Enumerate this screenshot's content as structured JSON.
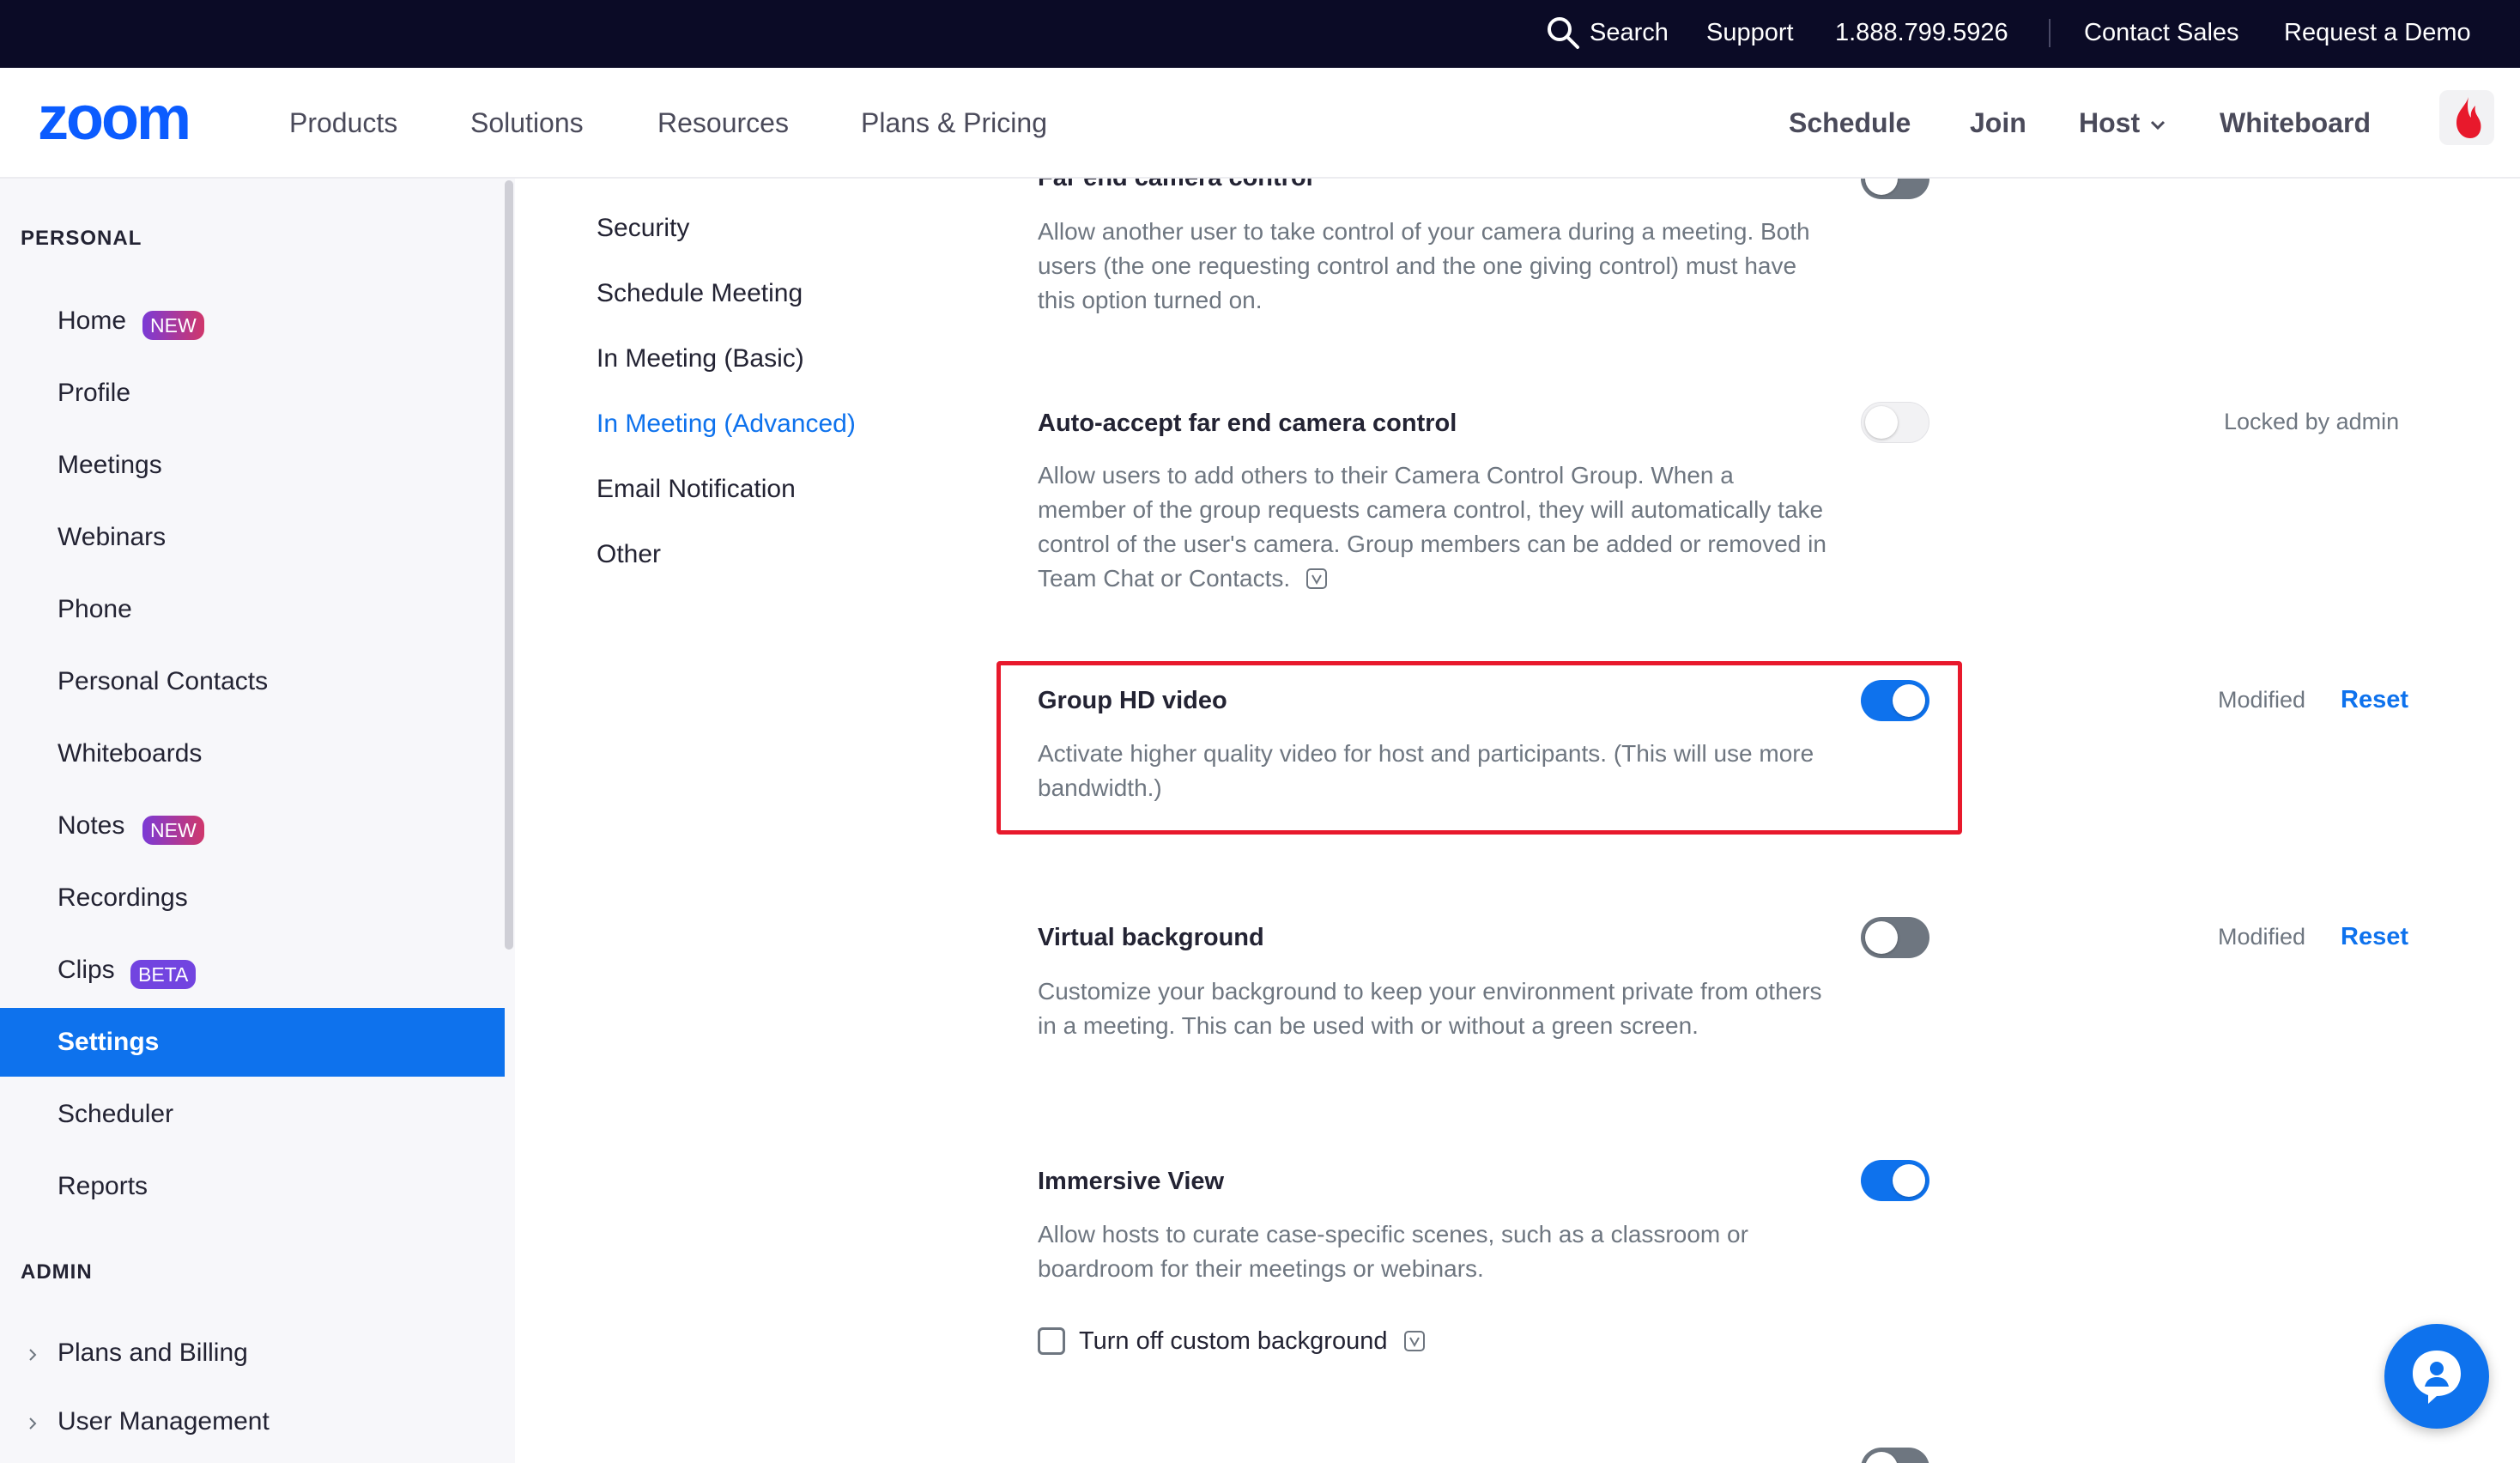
{
  "topbar": {
    "search": "Search",
    "support": "Support",
    "phone": "1.888.799.5926",
    "contact_sales": "Contact Sales",
    "request_demo": "Request a Demo"
  },
  "nav": {
    "logo": "zoom",
    "products": "Products",
    "solutions": "Solutions",
    "resources": "Resources",
    "plans": "Plans & Pricing",
    "schedule": "Schedule",
    "join": "Join",
    "host": "Host",
    "whiteboard": "Whiteboard"
  },
  "sidebar": {
    "personal_heading": "PERSONAL",
    "admin_heading": "ADMIN",
    "items": [
      {
        "label": "Home",
        "badge": "NEW"
      },
      {
        "label": "Profile"
      },
      {
        "label": "Meetings"
      },
      {
        "label": "Webinars"
      },
      {
        "label": "Phone"
      },
      {
        "label": "Personal Contacts"
      },
      {
        "label": "Whiteboards"
      },
      {
        "label": "Notes",
        "badge": "NEW"
      },
      {
        "label": "Recordings"
      },
      {
        "label": "Clips",
        "badge": "BETA"
      },
      {
        "label": "Settings",
        "active": true
      },
      {
        "label": "Scheduler"
      },
      {
        "label": "Reports"
      }
    ],
    "admin_items": [
      {
        "label": "Plans and Billing"
      },
      {
        "label": "User Management"
      }
    ]
  },
  "subnav": {
    "items": [
      "Security",
      "Schedule Meeting",
      "In Meeting (Basic)",
      "In Meeting (Advanced)",
      "Email Notification",
      "Other"
    ],
    "active": "In Meeting (Advanced)"
  },
  "settings": [
    {
      "title": "Far end camera control",
      "description": "Allow another user to take control of your camera during a meeting. Both users (the one requesting control and the one giving control) must have this option turned on.",
      "enabled": false
    },
    {
      "title": "Auto-accept far end camera control",
      "description": "Allow users to add others to their Camera Control Group. When a member of the group requests camera control, they will automatically take control of the user's camera. Group members can be added or removed in Team Chat or Contacts.",
      "enabled": false,
      "status": "Locked by admin"
    },
    {
      "title": "Group HD video",
      "description": "Activate higher quality video for host and participants. (This will use more bandwidth.)",
      "enabled": true,
      "status": "Modified",
      "action": "Reset"
    },
    {
      "title": "Virtual background",
      "description": "Customize your background to keep your environment private from others in a meeting. This can be used with or without a green screen.",
      "enabled": false,
      "status": "Modified",
      "action": "Reset"
    },
    {
      "title": "Immersive View",
      "description": "Allow hosts to curate case-specific scenes, such as a classroom or boardroom for their meetings or webinars.",
      "enabled": true,
      "option": {
        "label": "Turn off custom background",
        "checked": false
      }
    }
  ],
  "colors": {
    "accent": "#0e72ed",
    "topbar": "#0b0b26",
    "highlight": "#e8192c"
  }
}
